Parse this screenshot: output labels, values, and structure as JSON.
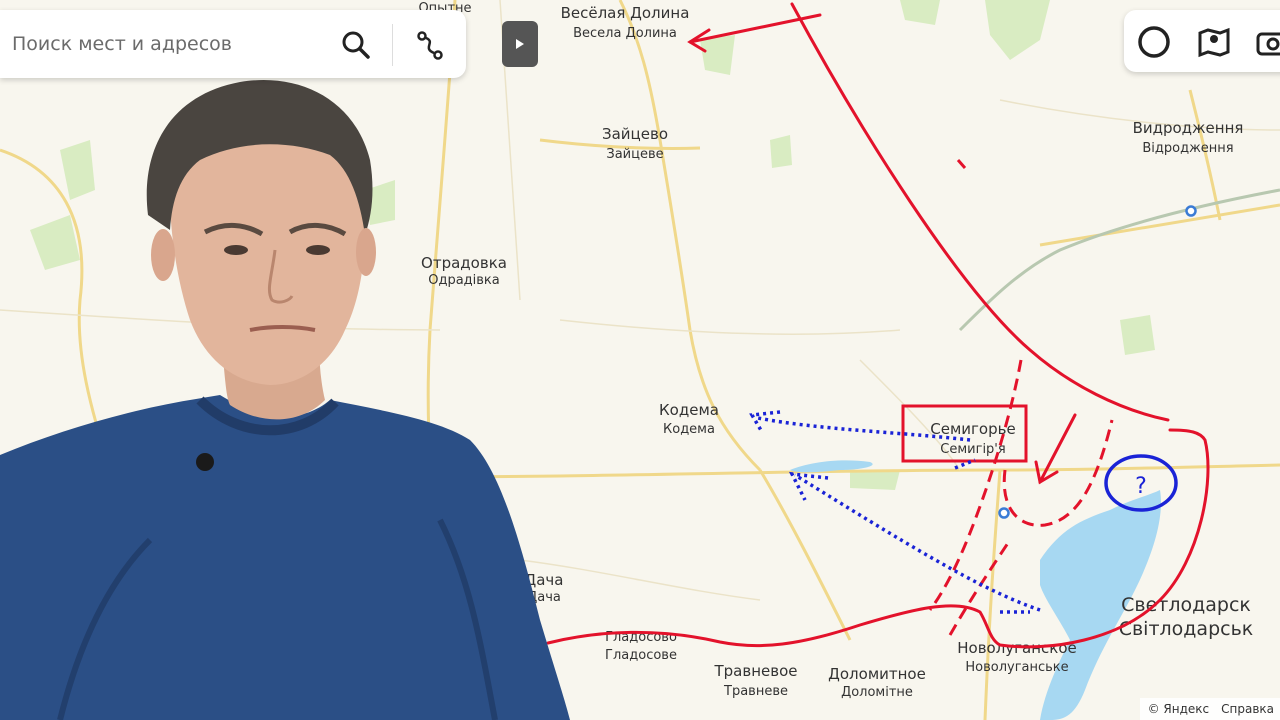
{
  "search": {
    "placeholder": "Поиск мест и адресов"
  },
  "places": {
    "veselaya_ru": "Весёлая Долина",
    "veselaya_ua": "Весела Долина",
    "opytne": "Опытне",
    "zaitsevo_ru": "Зайцево",
    "zaitsevo_ua": "Зайцеве",
    "vidrodzhennya_1": "Видродження",
    "vidrodzhennya_2": "Відродження",
    "otradovka_ru": "Отрадовка",
    "otradovka_ua": "Одрадівка",
    "kodema_ru": "Кодема",
    "kodema_ua": "Кодема",
    "semigorye_ru": "Семигорье",
    "semigorye_ua": "Семигір'я",
    "dacha_ru": "Дача",
    "dacha_ua": "Дача",
    "gladosovo_ru": "Гладосово",
    "gladosovo_ua": "Гладосове",
    "travnevoe_ru": "Травневое",
    "travnevoe_ua": "Травневе",
    "dolomitnoe_ru": "Доломитное",
    "dolomitnoe_ua": "Доломітне",
    "novoluganskoe_ru": "Новолуганское",
    "novoluganskoe_ua": "Новолуганське",
    "svetlodarsk_ru": "Светлодарск",
    "svetlodarsk_ua": "Світлодарськ"
  },
  "annotations": {
    "question_mark": "?"
  },
  "footer": {
    "copyright": "© Яндекс",
    "help": "Справка"
  },
  "colors": {
    "front_line": "#e3122b",
    "blue_marks": "#1a23d6",
    "water": "#a7d8f2",
    "field": "#f8f6ee",
    "road": "#f2dc95"
  },
  "icons": {
    "search": "search-icon",
    "route": "route-icon",
    "collapse": "play-arrow-icon",
    "layers": "layers-icon",
    "panorama": "panorama-icon",
    "camera": "camera-icon"
  }
}
